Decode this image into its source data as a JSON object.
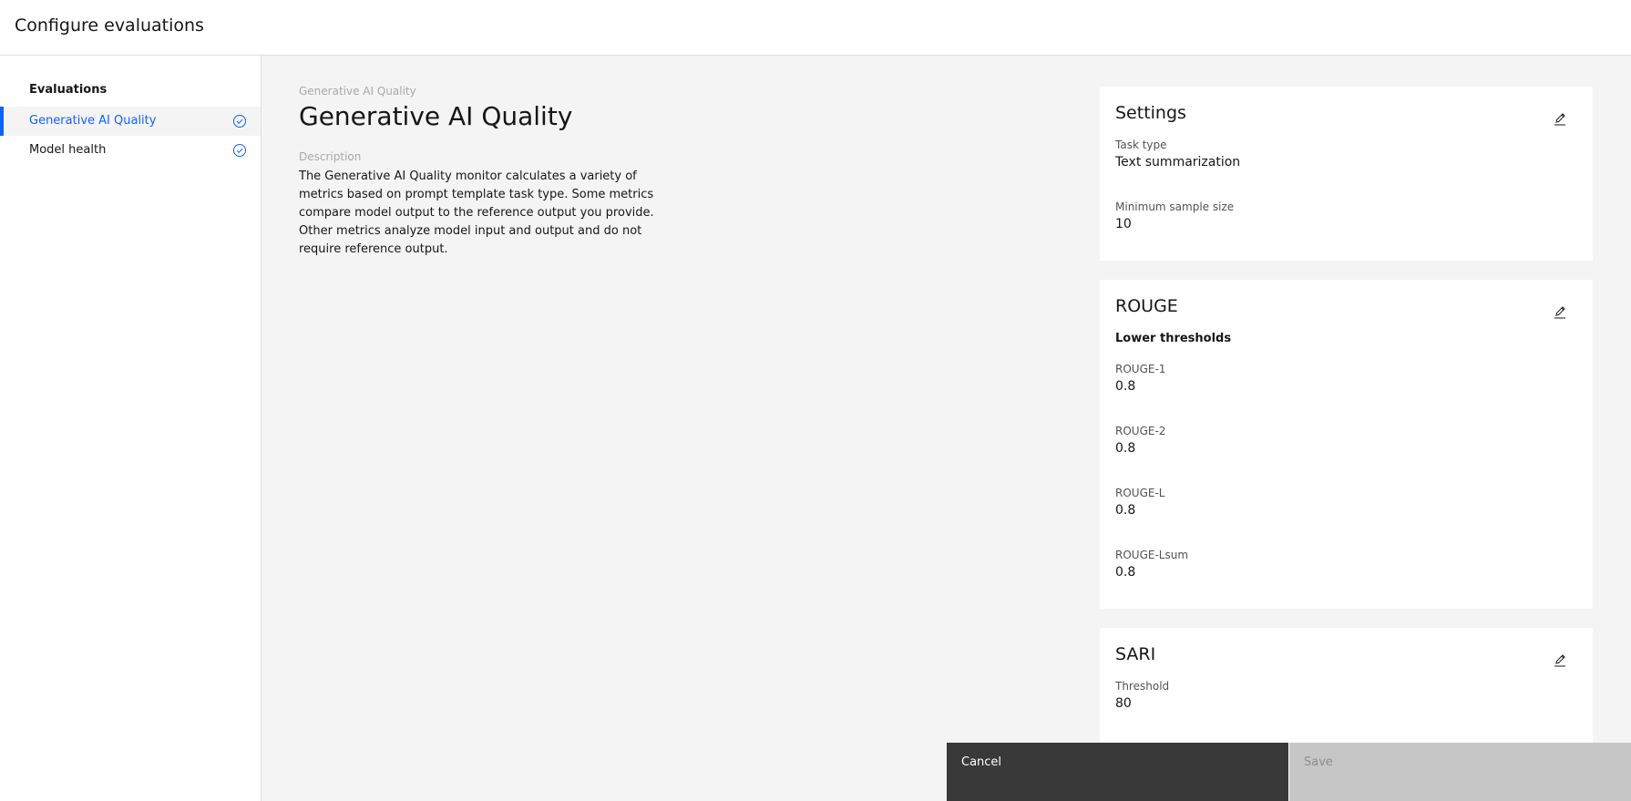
{
  "header": {
    "title": "Configure evaluations"
  },
  "sidebar": {
    "heading": "Evaluations",
    "items": [
      {
        "label": "Generative AI Quality",
        "active": true,
        "icon": "checkmark-outline-icon"
      },
      {
        "label": "Model health",
        "active": false,
        "icon": "checkmark-outline-icon"
      }
    ]
  },
  "main": {
    "breadcrumb": "Generative AI Quality",
    "title": "Generative AI Quality",
    "description_label": "Description",
    "description": "The Generative AI Quality monitor calculates a variety of metrics based on prompt template task type. Some metrics compare model output to the reference output you provide. Other metrics analyze model input and output and do not require reference output."
  },
  "cards": {
    "settings": {
      "title": "Settings",
      "fields": [
        {
          "label": "Task type",
          "value": "Text summarization"
        },
        {
          "label": "Minimum sample size",
          "value": "10"
        }
      ]
    },
    "rouge": {
      "title": "ROUGE",
      "subheading": "Lower thresholds",
      "fields": [
        {
          "label": "ROUGE-1",
          "value": "0.8"
        },
        {
          "label": "ROUGE-2",
          "value": "0.8"
        },
        {
          "label": "ROUGE-L",
          "value": "0.8"
        },
        {
          "label": "ROUGE-Lsum",
          "value": "0.8"
        }
      ]
    },
    "sari": {
      "title": "SARI",
      "fields": [
        {
          "label": "Threshold",
          "value": "80"
        }
      ]
    }
  },
  "footer": {
    "cancel_label": "Cancel",
    "save_label": "Save"
  },
  "colors": {
    "accent": "#0f62fe",
    "cancel_bg": "#393939",
    "save_disabled_bg": "#c6c6c6"
  }
}
